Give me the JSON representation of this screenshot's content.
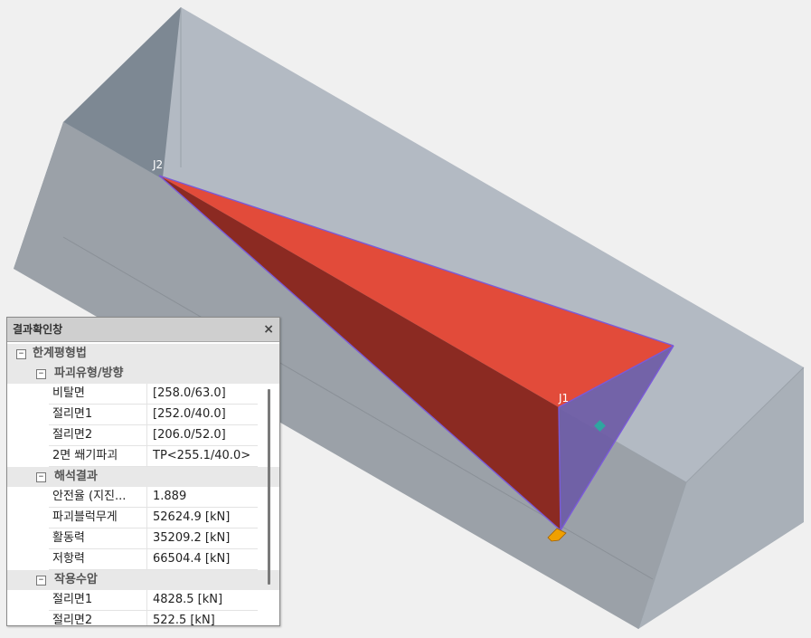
{
  "viewport": {
    "labels": {
      "j1": "J1",
      "j2": "J2"
    },
    "colors": {
      "background": "#f0f0f0",
      "block_top": "#b3bac3",
      "block_left": "#7d8893",
      "block_front": "#9ba1a8",
      "block_end": "#a9b0b8",
      "wedge_top": "#e24b3a",
      "wedge_side": "#8b2a22",
      "wedge_blue": "#6b5aa5",
      "edge": "#7a5ad8",
      "marker_orange": "#f0a000",
      "marker_teal": "#2fa6a0"
    }
  },
  "panel": {
    "title": "결과확인창",
    "close": "×",
    "root": {
      "toggle": "−",
      "label": "한계평형법",
      "groups": [
        {
          "toggle": "−",
          "label": "파괴유형/방향",
          "rows": [
            {
              "name": "비탈면",
              "value": "[258.0/63.0]"
            },
            {
              "name": "절리면1",
              "value": "[252.0/40.0]"
            },
            {
              "name": "절리면2",
              "value": "[206.0/52.0]"
            },
            {
              "name": "2면 쐐기파괴",
              "value": "TP<255.1/40.0>"
            }
          ]
        },
        {
          "toggle": "−",
          "label": "해석결과",
          "rows": [
            {
              "name": "안전율 (지진...",
              "value": "1.889"
            },
            {
              "name": "파괴블럭무게",
              "value": "52624.9 [kN]"
            },
            {
              "name": "활동력",
              "value": "35209.2 [kN]"
            },
            {
              "name": "저항력",
              "value": "66504.4 [kN]"
            }
          ]
        },
        {
          "toggle": "−",
          "label": "작용수압",
          "rows": [
            {
              "name": "절리면1",
              "value": "4828.5 [kN]"
            },
            {
              "name": "절리면2",
              "value": "522.5 [kN]"
            }
          ]
        }
      ]
    }
  }
}
